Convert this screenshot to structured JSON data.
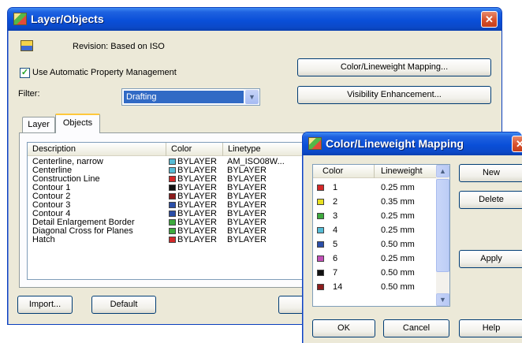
{
  "layer_objects": {
    "title": "Layer/Objects",
    "close_icon": "close-icon",
    "revision_text": "Revision: Based on ISO",
    "use_auto_property": "Use Automatic Property Management",
    "use_auto_checked": true,
    "filter_label": "Filter:",
    "filter_value": "Drafting",
    "color_mapping_button": "Color/Lineweight Mapping...",
    "visibility_button": "Visibility Enhancement...",
    "tabs": [
      {
        "label": "Layer",
        "active": false
      },
      {
        "label": "Objects",
        "active": true
      }
    ],
    "columns": [
      "Description",
      "Color",
      "Linetype"
    ],
    "rows": [
      {
        "description": "Centerline, narrow",
        "color": "BYLAYER",
        "swatch": "#55bcd6",
        "linetype": "AM_ISO08W..."
      },
      {
        "description": "Centerline",
        "color": "BYLAYER",
        "swatch": "#55bcd6",
        "linetype": "BYLAYER"
      },
      {
        "description": "Construction Line",
        "color": "BYLAYER",
        "swatch": "#d42828",
        "linetype": "BYLAYER"
      },
      {
        "description": "Contour 1",
        "color": "BYLAYER",
        "swatch": "#111111",
        "linetype": "BYLAYER"
      },
      {
        "description": "Contour 2",
        "color": "BYLAYER",
        "swatch": "#8c1c1c",
        "linetype": "BYLAYER"
      },
      {
        "description": "Contour 3",
        "color": "BYLAYER",
        "swatch": "#2a4ea8",
        "linetype": "BYLAYER"
      },
      {
        "description": "Contour 4",
        "color": "BYLAYER",
        "swatch": "#2a4ea8",
        "linetype": "BYLAYER"
      },
      {
        "description": "Detail Enlargement Border",
        "color": "BYLAYER",
        "swatch": "#3daa3d",
        "linetype": "BYLAYER"
      },
      {
        "description": "Diagonal Cross for Planes",
        "color": "BYLAYER",
        "swatch": "#3daa3d",
        "linetype": "BYLAYER"
      },
      {
        "description": "Hatch",
        "color": "BYLAYER",
        "swatch": "#d42828",
        "linetype": "BYLAYER"
      }
    ],
    "import_button": "Import...",
    "default_button": "Default"
  },
  "mapping": {
    "title": "Color/Lineweight Mapping",
    "columns": [
      "Color",
      "Lineweight"
    ],
    "rows": [
      {
        "color": "1",
        "swatch": "#d42828",
        "lineweight": "0.25 mm"
      },
      {
        "color": "2",
        "swatch": "#e8e020",
        "lineweight": "0.35 mm"
      },
      {
        "color": "3",
        "swatch": "#3daa3d",
        "lineweight": "0.25 mm"
      },
      {
        "color": "4",
        "swatch": "#55bcd6",
        "lineweight": "0.25 mm"
      },
      {
        "color": "5",
        "swatch": "#2a4ea8",
        "lineweight": "0.50 mm"
      },
      {
        "color": "6",
        "swatch": "#c24fb8",
        "lineweight": "0.25 mm"
      },
      {
        "color": "7",
        "swatch": "#111111",
        "lineweight": "0.50 mm"
      },
      {
        "color": "14",
        "swatch": "#8c1c1c",
        "lineweight": "0.50 mm"
      }
    ],
    "new_button": "New",
    "delete_button": "Delete",
    "apply_button": "Apply",
    "ok_button": "OK",
    "cancel_button": "Cancel",
    "help_button": "Help"
  }
}
